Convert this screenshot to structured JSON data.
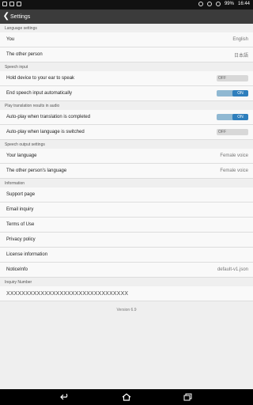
{
  "status": {
    "battery": "99%",
    "time": "16:44"
  },
  "app_bar": {
    "title": "Settings"
  },
  "sections": {
    "language": {
      "header": "Language settings",
      "you_label": "You",
      "you_value": "English",
      "other_label": "The other person",
      "other_value": "日本語"
    },
    "speech_input": {
      "header": "Speech input",
      "hold_label": "Hold device to your ear to speak",
      "hold_state": "OFF",
      "end_label": "End speech input automatically",
      "end_state": "ON"
    },
    "play_audio": {
      "header": "Play translation results in audio",
      "auto_complete_label": "Auto-play when translation is completed",
      "auto_complete_state": "ON",
      "auto_switch_label": "Auto-play when language is switched",
      "auto_switch_state": "OFF"
    },
    "speech_output": {
      "header": "Speech output settings",
      "your_lang_label": "Your language",
      "your_lang_value": "Female voice",
      "other_lang_label": "The other person's language",
      "other_lang_value": "Female voice"
    },
    "information": {
      "header": "Information",
      "support": "Support page",
      "email": "Email inquiry",
      "terms": "Terms of Use",
      "privacy": "Privacy policy",
      "license": "License information",
      "notice_label": "NoticeInfo",
      "notice_value": "default-v1.json"
    },
    "inquiry": {
      "header": "Inquiry Number",
      "value": "XXXXXXXXXXXXXXXXXXXXXXXXXXXXXXXX"
    }
  },
  "version": "Version 6.9"
}
